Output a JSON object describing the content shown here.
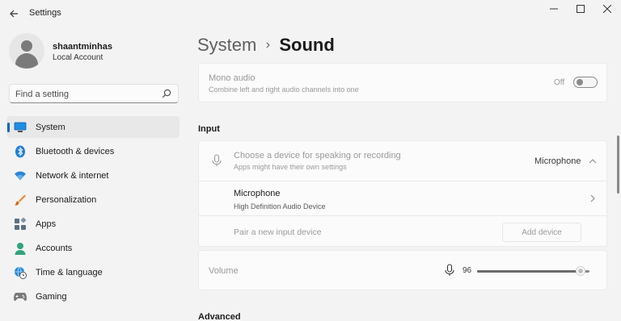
{
  "window": {
    "title": "Settings"
  },
  "profile": {
    "name": "shaantminhas",
    "account_type": "Local Account"
  },
  "search": {
    "placeholder": "Find a setting"
  },
  "sidebar": {
    "items": [
      {
        "label": "System",
        "icon": "monitor-icon",
        "active": true
      },
      {
        "label": "Bluetooth & devices",
        "icon": "bluetooth-icon"
      },
      {
        "label": "Network & internet",
        "icon": "wifi-icon"
      },
      {
        "label": "Personalization",
        "icon": "brush-icon"
      },
      {
        "label": "Apps",
        "icon": "apps-icon"
      },
      {
        "label": "Accounts",
        "icon": "person-icon"
      },
      {
        "label": "Time & language",
        "icon": "globe-clock-icon"
      },
      {
        "label": "Gaming",
        "icon": "gamepad-icon"
      }
    ]
  },
  "breadcrumb": {
    "parent": "System",
    "separator": "›",
    "current": "Sound"
  },
  "mono_audio": {
    "title": "Mono audio",
    "description": "Combine left and right audio channels into one",
    "state_label": "Off",
    "enabled": false
  },
  "input_section": {
    "title": "Input",
    "chooser": {
      "title": "Choose a device for speaking or recording",
      "description": "Apps might have their own settings",
      "selected": "Microphone"
    },
    "device": {
      "name": "Microphone",
      "description": "High Definition Audio Device"
    },
    "pair": {
      "label": "Pair a new input device",
      "button": "Add device"
    }
  },
  "volume": {
    "label": "Volume",
    "value": "96",
    "level": 96
  },
  "advanced_section": {
    "title": "Advanced"
  },
  "colors": {
    "accent": "#0067c0"
  }
}
